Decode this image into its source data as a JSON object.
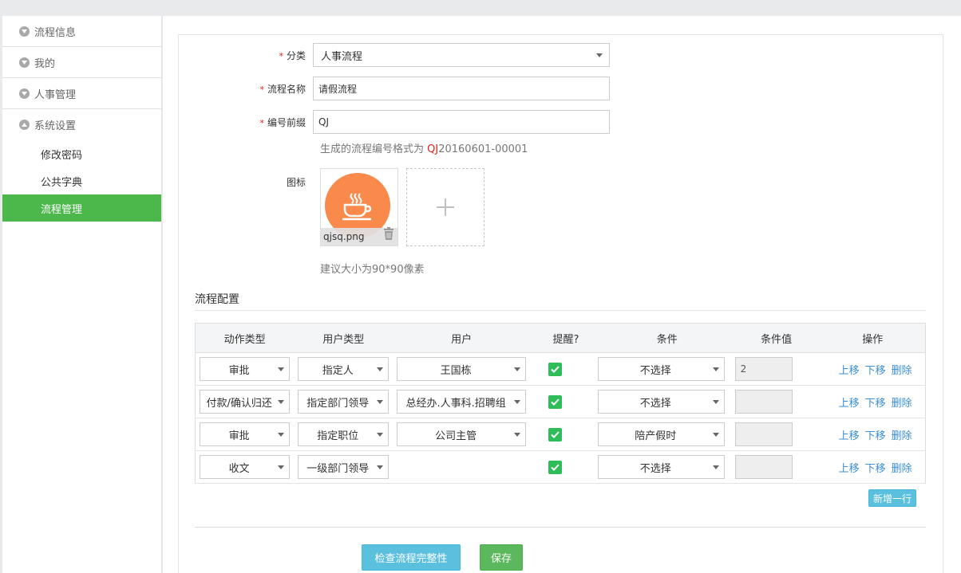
{
  "sidebar": {
    "groups": [
      "流程信息",
      "我的",
      "人事管理",
      "系统设置"
    ],
    "sub_items": [
      "修改密码",
      "公共字典",
      "流程管理"
    ]
  },
  "form": {
    "category": {
      "label": "分类",
      "value": "人事流程"
    },
    "name": {
      "label": "流程名称",
      "value": "请假流程"
    },
    "prefix": {
      "label": "编号前缀",
      "value": "QJ"
    },
    "format_hint": {
      "text": "生成的流程编号格式为 ",
      "prefix": "QJ",
      "suffix": "20160601-00001"
    },
    "icon": {
      "label": "图标",
      "filename": "qjsq.png",
      "size_hint": "建议大小为90*90像素"
    }
  },
  "config": {
    "title": "流程配置",
    "headers": [
      "动作类型",
      "用户类型",
      "用户",
      "提醒?",
      "条件",
      "条件值",
      "操作"
    ],
    "rows": [
      {
        "action": "审批",
        "user_type": "指定人",
        "user": "王国栋",
        "remind": true,
        "condition": "不选择",
        "cond_value": "2"
      },
      {
        "action": "付款/确认归还",
        "user_type": "指定部门领导",
        "user": "总经办.人事科.招聘组",
        "remind": true,
        "condition": "不选择",
        "cond_value": ""
      },
      {
        "action": "审批",
        "user_type": "指定职位",
        "user": "公司主管",
        "remind": true,
        "condition": "陪产假时",
        "cond_value": ""
      },
      {
        "action": "收文",
        "user_type": "一级部门领导",
        "user": "",
        "remind": true,
        "condition": "不选择",
        "cond_value": ""
      }
    ],
    "ops": {
      "up": "上移",
      "down": "下移",
      "delete": "删除"
    },
    "add_row": "新增一行"
  },
  "actions": {
    "check": "检查流程完整性",
    "save": "保存"
  },
  "colors": {
    "accent": "#4cb84c",
    "info": "#5bc0de",
    "link": "#3b8fd6",
    "icon_bg": "#f98a4c"
  }
}
